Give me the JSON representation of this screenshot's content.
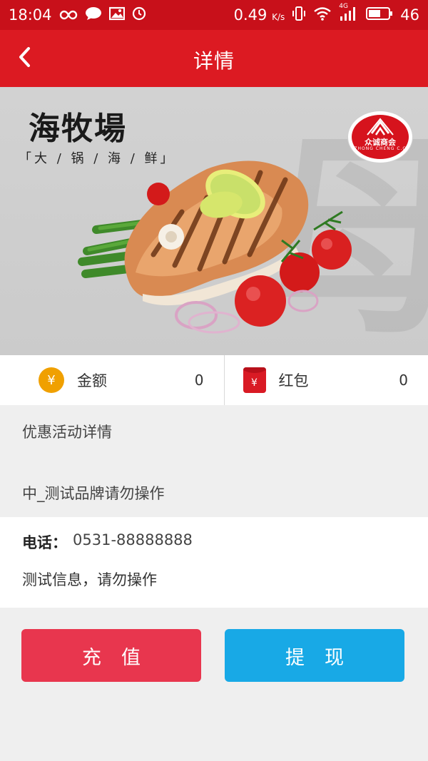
{
  "status_bar": {
    "time": "18:04",
    "net_speed": "0.49",
    "net_speed_unit": "K/s",
    "network": "4G",
    "battery": "46"
  },
  "header": {
    "title": "详情",
    "back_icon": "chevron-left-icon"
  },
  "banner": {
    "brand_name": "海牧場",
    "brand_slogan": "「大 / 锅 / 海 / 鲜」",
    "partner_logo_name": "众诚商会",
    "partner_logo_en": "ZHONG CHENG C.C"
  },
  "stats": {
    "amount": {
      "label": "金额",
      "value": "0",
      "icon": "coin-yen-icon"
    },
    "red_packet": {
      "label": "红包",
      "value": "0",
      "icon": "red-packet-icon"
    }
  },
  "promo": {
    "title": "优惠活动详情",
    "text": "中_测试品牌请勿操作"
  },
  "contact": {
    "phone_label": "电话：",
    "phone_value": "0531-88888888",
    "info": "测试信息，请勿操作"
  },
  "actions": {
    "recharge_label": "充值",
    "withdraw_label": "提现"
  },
  "colors": {
    "brand_red": "#dc1a22",
    "recharge": "#e8364e",
    "withdraw": "#18a9e6"
  }
}
